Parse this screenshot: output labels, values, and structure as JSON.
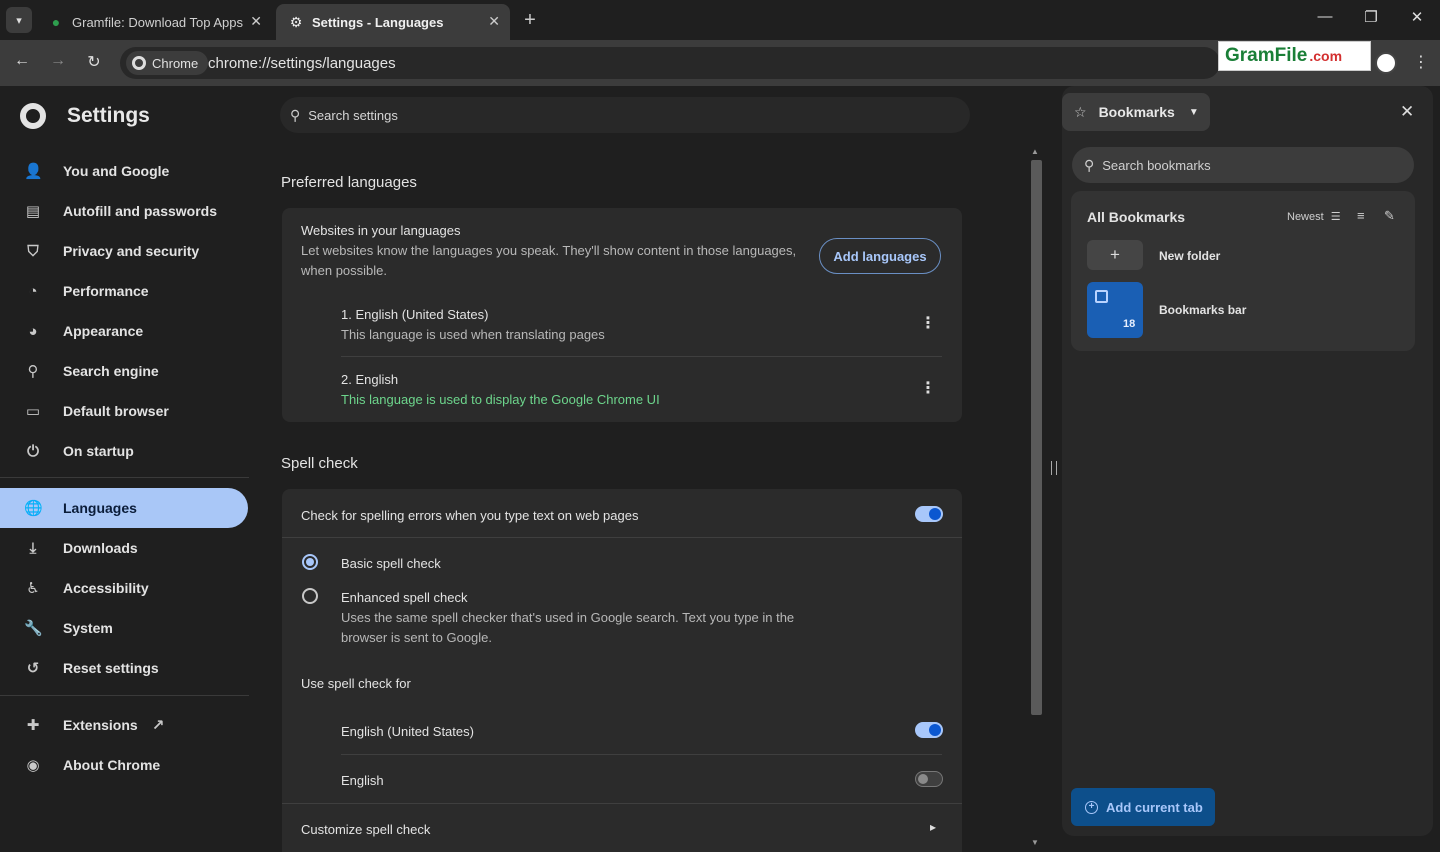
{
  "tabs": [
    {
      "title": "Gramfile: Download Top Apps",
      "icon": "gramfile-icon",
      "active": false
    },
    {
      "title": "Settings - Languages",
      "icon": "gear-icon",
      "active": true
    }
  ],
  "toolbar": {
    "chip_label": "Chrome",
    "url": "chrome://settings/languages",
    "watermark": {
      "brand": "GramFile",
      "dot": ".com"
    }
  },
  "sidebar": {
    "title": "Settings",
    "items": [
      {
        "label": "You and Google",
        "icon": "person-icon"
      },
      {
        "label": "Autofill and passwords",
        "icon": "clipboard-icon"
      },
      {
        "label": "Privacy and security",
        "icon": "shield-icon"
      },
      {
        "label": "Performance",
        "icon": "speedometer-icon"
      },
      {
        "label": "Appearance",
        "icon": "palette-icon"
      },
      {
        "label": "Search engine",
        "icon": "search-icon"
      },
      {
        "label": "Default browser",
        "icon": "browser-icon"
      },
      {
        "label": "On startup",
        "icon": "power-icon"
      },
      {
        "label": "Languages",
        "icon": "globe-icon",
        "selected": true
      },
      {
        "label": "Downloads",
        "icon": "download-icon"
      },
      {
        "label": "Accessibility",
        "icon": "accessibility-icon"
      },
      {
        "label": "System",
        "icon": "wrench-icon"
      },
      {
        "label": "Reset settings",
        "icon": "history-icon"
      },
      {
        "label": "Extensions",
        "icon": "puzzle-icon"
      },
      {
        "label": "About Chrome",
        "icon": "chrome-icon"
      }
    ]
  },
  "search": {
    "placeholder": "Search settings"
  },
  "preferred": {
    "heading": "Preferred languages",
    "card_title": "Websites in your languages",
    "card_desc_line1": "Let websites know the languages you speak. They'll show content in those languages,",
    "card_desc_line2": "when possible.",
    "add_button": "Add languages",
    "languages": [
      {
        "name": "1. English (United States)",
        "note": "This language is used when translating pages"
      },
      {
        "name": "2. English",
        "note": "This language is used to display the Google Chrome UI"
      }
    ]
  },
  "spellcheck": {
    "heading": "Spell check",
    "toggle_label": "Check for spelling errors when you type text on web pages",
    "toggle_on": true,
    "basic_label": "Basic spell check",
    "enhanced_label": "Enhanced spell check",
    "enhanced_desc_line1": "Uses the same spell checker that's used in Google search. Text you type in the",
    "enhanced_desc_line2": "browser is sent to Google.",
    "use_for_heading": "Use spell check for",
    "languages": [
      {
        "name": "English (United States)",
        "enabled": true
      },
      {
        "name": "English",
        "enabled": false
      }
    ],
    "customize_label": "Customize spell check"
  },
  "bookmarks": {
    "header": "Bookmarks",
    "search_placeholder": "Search bookmarks",
    "section_title": "All Bookmarks",
    "sort_label": "Newest",
    "new_folder_label": "New folder",
    "bar_label": "Bookmarks bar",
    "bar_count": "18",
    "add_tab_label": "Add current tab"
  },
  "colors": {
    "accent": "#a8c7fa",
    "selected_nav": "#a9c7f7",
    "green_note": "#6dd58c"
  }
}
